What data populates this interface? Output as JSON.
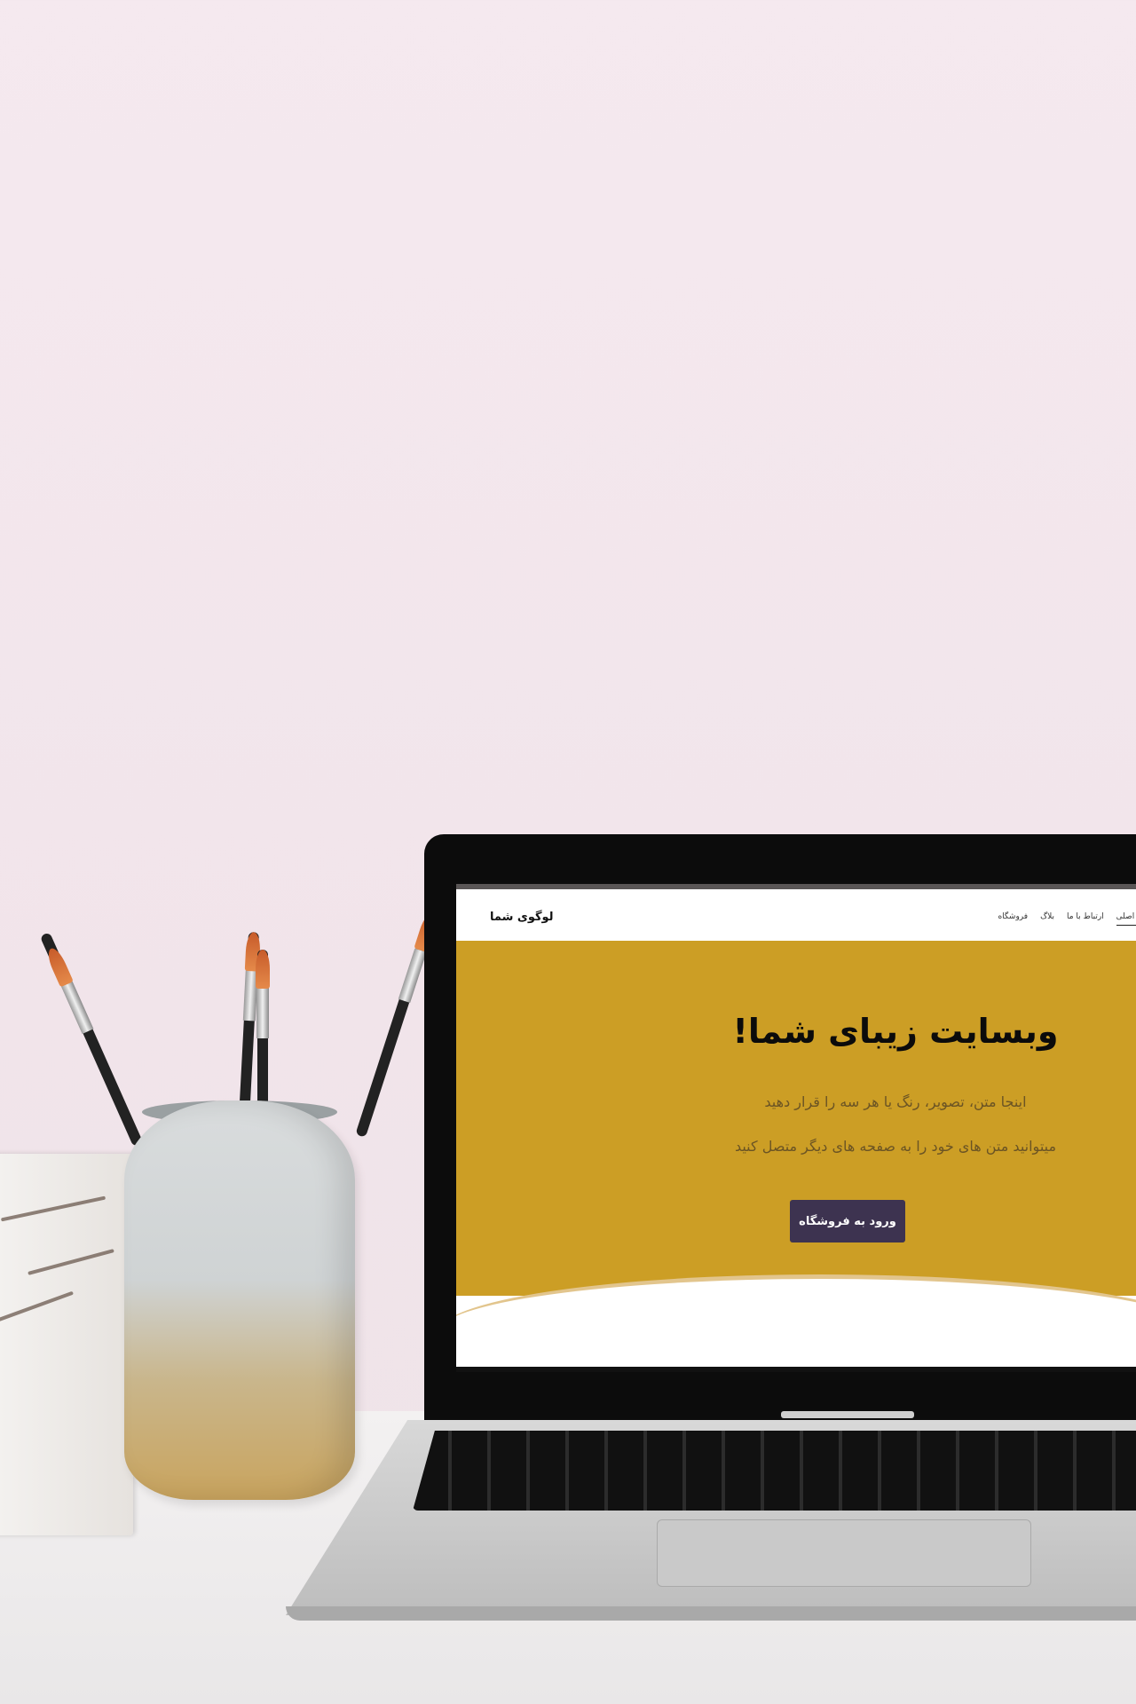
{
  "site": {
    "logo": "لوگوی شما",
    "nav": [
      "صفحه اصلی",
      "ارتباط با ما",
      "بلاگ",
      "فروشگاه"
    ],
    "active_nav": "صفحه اصلی",
    "hero": {
      "title": "وبسایت زیبای شما!",
      "line1": "اینجا متن، تصویر، رنگ یا هر سه را قرار دهید",
      "line2": "میتوانید متن های خود را به صفحه های دیگر متصل کنید",
      "button": "ورود به فروشگاه"
    }
  },
  "colors": {
    "wall": "#f3e7ed",
    "hero_background": "#cc9e25",
    "button": "#3d3350",
    "laptop_bezel": "#0c0c0c"
  }
}
